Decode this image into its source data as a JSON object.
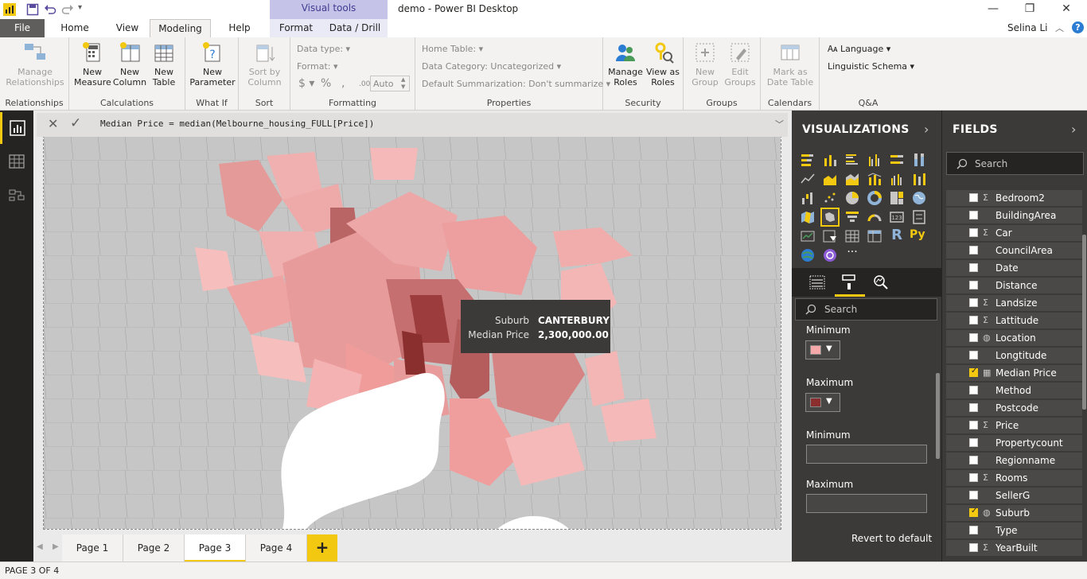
{
  "window": {
    "title": "demo - Power BI Desktop",
    "contextual_band": "Visual tools",
    "user": "Selina Li",
    "help": "?"
  },
  "tabs": {
    "file": "File",
    "home": "Home",
    "view": "View",
    "modeling": "Modeling",
    "help": "Help",
    "format": "Format",
    "data_drill": "Data / Drill"
  },
  "ribbon": {
    "relationships": {
      "manage_line1": "Manage",
      "manage_line2": "Relationships",
      "group": "Relationships"
    },
    "calculations": {
      "new_measure_1": "New",
      "new_measure_2": "Measure",
      "new_column_1": "New",
      "new_column_2": "Column",
      "new_table_1": "New",
      "new_table_2": "Table",
      "group": "Calculations"
    },
    "whatif": {
      "new_param_1": "New",
      "new_param_2": "Parameter",
      "group": "What If"
    },
    "sort": {
      "sort_by_1": "Sort by",
      "sort_by_2": "Column",
      "group": "Sort"
    },
    "formatting": {
      "data_type": "Data type:",
      "format": "Format:",
      "currency": "$",
      "percent": "%",
      "comma": ",",
      "decimals": ".00",
      "auto": "Auto",
      "group": "Formatting"
    },
    "properties": {
      "home_table": "Home Table:",
      "data_category": "Data Category: Uncategorized",
      "default_summ": "Default Summarization: Don't summarize",
      "group": "Properties"
    },
    "security": {
      "manage_roles_1": "Manage",
      "manage_roles_2": "Roles",
      "view_as_1": "View as",
      "view_as_2": "Roles",
      "group": "Security"
    },
    "groups": {
      "new_group_1": "New",
      "new_group_2": "Group",
      "edit_groups_1": "Edit",
      "edit_groups_2": "Groups",
      "group": "Groups"
    },
    "calendars": {
      "mark_1": "Mark as",
      "mark_2": "Date Table",
      "group": "Calendars"
    },
    "qa": {
      "language": "Language",
      "linguistic": "Linguistic Schema",
      "group": "Q&A"
    }
  },
  "formula": "Median Price = median(Melbourne_housing_FULL[Price])",
  "tooltip": {
    "key1": "Suburb",
    "val1": "CANTERBURY",
    "key2": "Median Price",
    "val2": "2,300,000.00"
  },
  "pages": [
    "Page 1",
    "Page 2",
    "Page 3",
    "Page 4"
  ],
  "add_page": "+",
  "status": "PAGE 3 OF 4",
  "visualizations": {
    "title": "VISUALIZATIONS",
    "search_placeholder": "Search",
    "min_label_1": "Minimum",
    "max_label_1": "Maximum",
    "min_label_2": "Minimum",
    "max_label_2": "Maximum",
    "min_color": "#f4a9a8",
    "max_color": "#8b2e2e",
    "revert": "Revert to default"
  },
  "fields": {
    "title": "FIELDS",
    "search_placeholder": "Search",
    "items": [
      {
        "name": "Bedroom2",
        "type": "Σ",
        "checked": false
      },
      {
        "name": "BuildingArea",
        "type": "",
        "checked": false
      },
      {
        "name": "Car",
        "type": "Σ",
        "checked": false
      },
      {
        "name": "CouncilArea",
        "type": "",
        "checked": false
      },
      {
        "name": "Date",
        "type": "",
        "checked": false
      },
      {
        "name": "Distance",
        "type": "",
        "checked": false
      },
      {
        "name": "Landsize",
        "type": "Σ",
        "checked": false
      },
      {
        "name": "Lattitude",
        "type": "Σ",
        "checked": false
      },
      {
        "name": "Location",
        "type": "globe",
        "checked": false
      },
      {
        "name": "Longtitude",
        "type": "",
        "checked": false
      },
      {
        "name": "Median Price",
        "type": "calc",
        "checked": true
      },
      {
        "name": "Method",
        "type": "",
        "checked": false
      },
      {
        "name": "Postcode",
        "type": "",
        "checked": false
      },
      {
        "name": "Price",
        "type": "Σ",
        "checked": false
      },
      {
        "name": "Propertycount",
        "type": "",
        "checked": false
      },
      {
        "name": "Regionname",
        "type": "",
        "checked": false
      },
      {
        "name": "Rooms",
        "type": "Σ",
        "checked": false
      },
      {
        "name": "SellerG",
        "type": "",
        "checked": false
      },
      {
        "name": "Suburb",
        "type": "globe",
        "checked": true
      },
      {
        "name": "Type",
        "type": "",
        "checked": false
      },
      {
        "name": "YearBuilt",
        "type": "Σ",
        "checked": false
      }
    ]
  }
}
